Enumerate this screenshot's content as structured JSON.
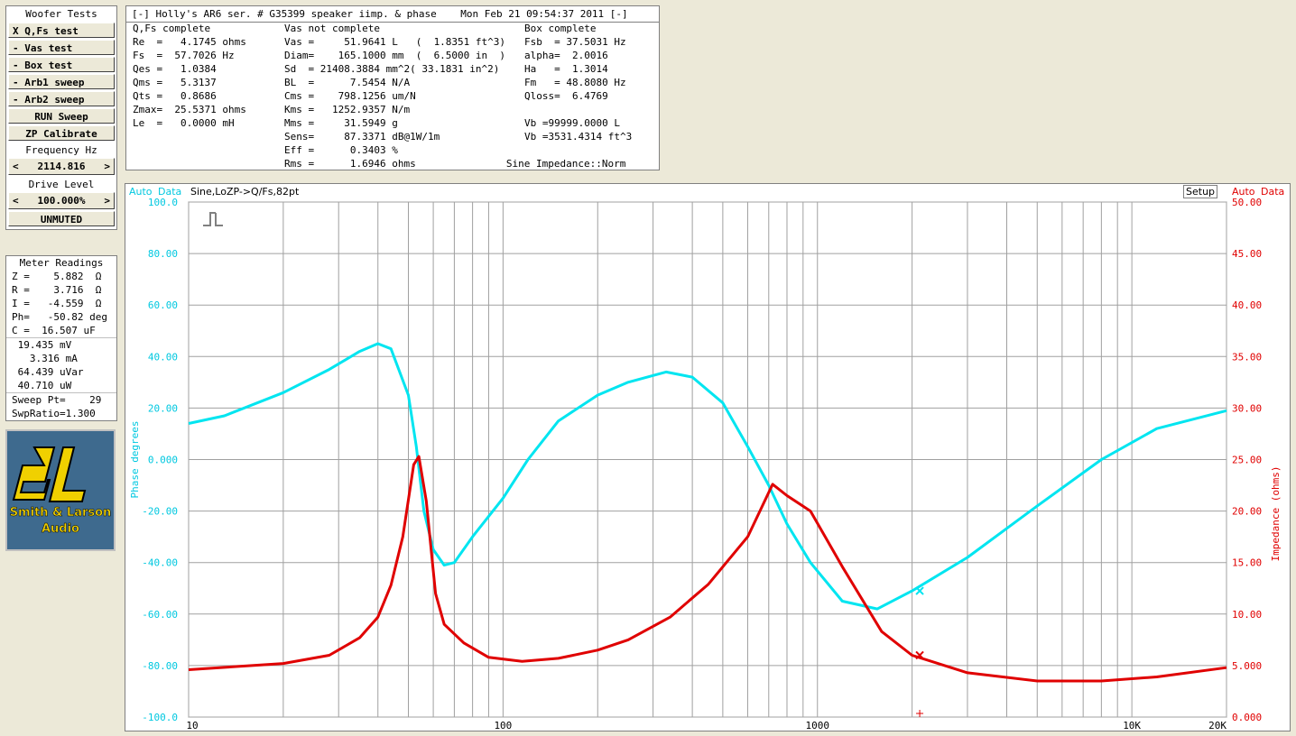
{
  "sidebar": {
    "title": "Woofer Tests",
    "buttons": [
      "X Q,Fs test",
      "- Vas test",
      "- Box test",
      "- Arb1 sweep",
      "- Arb2 sweep",
      "RUN Sweep",
      "ZP Calibrate"
    ],
    "freq_label": "Frequency Hz",
    "freq_left": "<",
    "freq_value": "2114.816",
    "freq_right": ">",
    "drive_label": "Drive Level",
    "drive_left": "<",
    "drive_value": "100.000%",
    "drive_right": ">",
    "mute": "UNMUTED"
  },
  "meter": {
    "title": "Meter Readings",
    "rows": [
      "Z =    5.882  Ω",
      "R =    3.716  Ω",
      "I =   -4.559  Ω",
      "Ph=   -50.82 deg",
      "C =  16.507 uF"
    ],
    "rows2": [
      " 19.435 mV",
      "   3.316 mA",
      " 64.439 uVar",
      " 40.710 uW"
    ],
    "rows3": [
      "Sweep Pt=    29",
      "SwpRatio=1.300"
    ]
  },
  "logo": {
    "line1": "Smith & Larson",
    "line2": "Audio"
  },
  "results": {
    "title": "[-] Holly's AR6 ser. # G35399 speaker iimp. & phase    Mon Feb 21 09:54:37 2011 [-]",
    "col1": [
      "Q,Fs complete",
      "Re  =   4.1745 ohms",
      "Fs  =  57.7026 Hz",
      "Qes =   1.0384",
      "Qms =   5.3137",
      "Qts =   0.8686",
      "Zmax=  25.5371 ohms",
      "Le  =   0.0000 mH"
    ],
    "col2": [
      "Vas not complete",
      "Vas =     51.9641 L   (  1.8351 ft^3)",
      "Diam=    165.1000 mm  (  6.5000 in  )",
      "Sd  = 21408.3884 mm^2( 33.1831 in^2)",
      "BL  =      7.5454 N/A",
      "Cms =    798.1256 um/N",
      "Kms =   1252.9357 N/m",
      "Mms =     31.5949 g",
      "Sens=     87.3371 dB@1W/1m",
      "Eff =      0.3403 %",
      "Rms =      1.6946 ohms"
    ],
    "col3": [
      "Box complete",
      "Fsb  = 37.5031 Hz",
      "alpha=  2.0016",
      "Ha   =  1.3014",
      "Fm   = 48.8080 Hz",
      "Qloss=  6.4769",
      "",
      "Vb =99999.0000 L",
      "Vb =3531.4314 ft^3",
      "",
      "   Sine Impedance::Norm"
    ]
  },
  "graph": {
    "left_auto": "Auto",
    "left_data": "Data",
    "description": "Sine,LoZP->Q/Fs,82pt",
    "setup": "Setup",
    "right_auto": "Auto",
    "right_data": "Data",
    "phase_color": "#00e5f0",
    "impedance_color": "#e00000"
  },
  "chart_data": {
    "type": "line",
    "xlabel": "",
    "ylabel": "Phase degrees",
    "y2label": "Impedance (ohms)",
    "xscale": "log",
    "xlim": [
      10,
      20000
    ],
    "ylim": [
      -100,
      100
    ],
    "y2lim": [
      0,
      50
    ],
    "x_ticks": [
      "10",
      "100",
      "1000",
      "10K",
      "20K"
    ],
    "y_ticks": [
      "100.0",
      "80.00",
      "60.00",
      "40.00",
      "20.00",
      "0.000",
      "-20.00",
      "-40.00",
      "-60.00",
      "-80.00",
      "-100.0"
    ],
    "y2_ticks": [
      "50.00",
      "45.00",
      "40.00",
      "35.00",
      "30.00",
      "25.00",
      "20.00",
      "15.00",
      "10.00",
      "5.000",
      "0.000"
    ],
    "grid": true,
    "series": [
      {
        "name": "Phase",
        "axis": "left",
        "x": [
          10,
          13,
          20,
          28,
          35,
          40,
          44,
          50,
          53,
          56,
          60,
          65,
          70,
          80,
          100,
          120,
          150,
          200,
          250,
          330,
          400,
          500,
          600,
          700,
          800,
          950,
          1200,
          1550,
          2000,
          3000,
          5000,
          8000,
          12000,
          20000
        ],
        "y": [
          14,
          17,
          26,
          35,
          42,
          45,
          43,
          25,
          5,
          -20,
          -35,
          -41,
          -40,
          -30,
          -15,
          0,
          15,
          25,
          30,
          34,
          32,
          22,
          5,
          -10,
          -25,
          -40,
          -55,
          -58,
          -51,
          -38,
          -18,
          0,
          12,
          19
        ]
      },
      {
        "name": "Impedance",
        "axis": "right",
        "x": [
          10,
          20,
          28,
          35,
          40,
          44,
          48,
          52,
          54,
          57,
          61,
          65,
          75,
          90,
          115,
          150,
          200,
          250,
          340,
          450,
          600,
          720,
          800,
          950,
          1200,
          1600,
          2000,
          3000,
          5000,
          8000,
          12000,
          20000
        ],
        "y": [
          4.6,
          5.2,
          6.0,
          7.7,
          9.7,
          12.8,
          17.5,
          24.5,
          25.3,
          21.0,
          12.0,
          9.0,
          7.2,
          5.8,
          5.4,
          5.7,
          6.5,
          7.5,
          9.7,
          12.9,
          17.5,
          22.6,
          21.5,
          20.0,
          14.6,
          8.3,
          6.0,
          4.3,
          3.5,
          3.5,
          3.9,
          4.8
        ]
      }
    ]
  }
}
